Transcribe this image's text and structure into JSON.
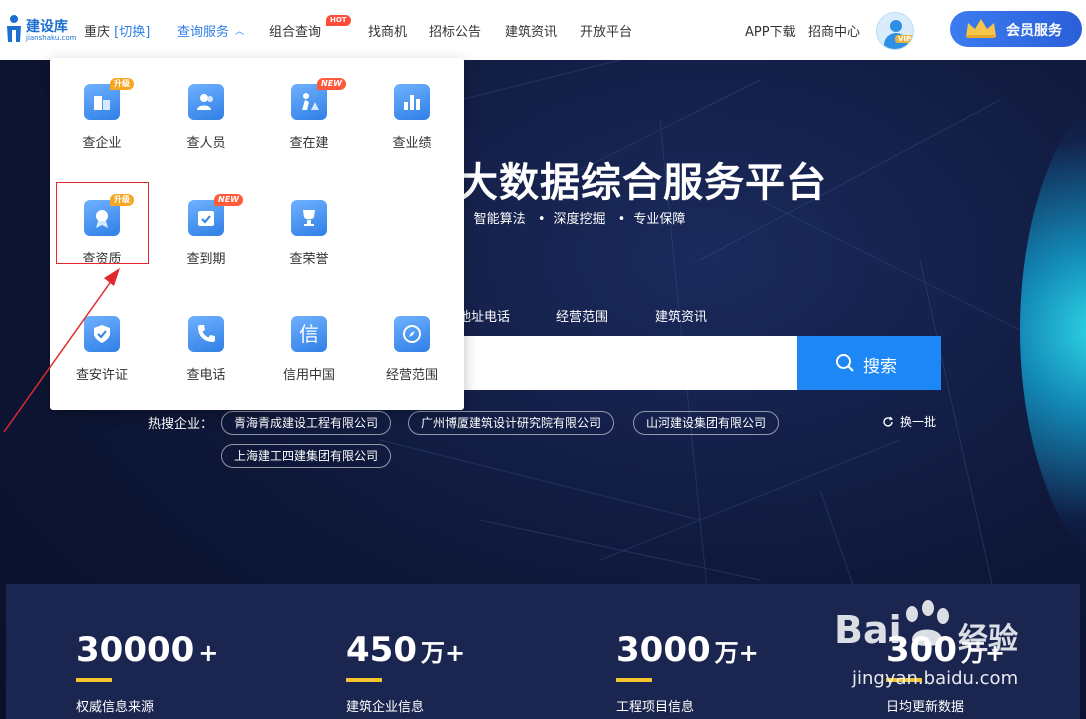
{
  "header": {
    "logo_name": "建设库",
    "logo_sub": "jianshaku.com",
    "city": "重庆",
    "city_switch": "[切换]",
    "nav": [
      {
        "label": "查询服务",
        "active": true
      },
      {
        "label": "组合查询",
        "badge": "HOT"
      },
      {
        "label": "找商机"
      },
      {
        "label": "招标公告"
      },
      {
        "label": "建筑资讯"
      },
      {
        "label": "开放平台"
      }
    ],
    "app_download": "APP下载",
    "merchant": "招商中心",
    "vip_tag": "VIP",
    "member_button": "会员服务"
  },
  "dropdown": {
    "items": [
      {
        "label": "查企业",
        "badge": "升级",
        "icon": "building-icon"
      },
      {
        "label": "查人员",
        "icon": "people-icon"
      },
      {
        "label": "查在建",
        "badge": "NEW",
        "icon": "construction-worker-icon"
      },
      {
        "label": "查业绩",
        "icon": "bar-chart-icon"
      },
      {
        "label": "查资质",
        "badge": "升级",
        "icon": "award-ribbon-icon"
      },
      {
        "label": "查到期",
        "badge": "NEW",
        "icon": "calendar-check-icon"
      },
      {
        "label": "查荣誉",
        "icon": "trophy-icon"
      },
      {
        "label": "查安许证",
        "icon": "shield-check-icon"
      },
      {
        "label": "查电话",
        "icon": "phone-icon"
      },
      {
        "label": "信用中国",
        "icon_text": "信",
        "icon": "credit-icon"
      },
      {
        "label": "经营范围",
        "icon": "compass-icon"
      }
    ]
  },
  "hero": {
    "title": "大数据综合服务平台",
    "tags": [
      "智能算法",
      "深度挖掘",
      "专业保障"
    ],
    "search_tabs": [
      "地址电话",
      "经营范围",
      "建筑资讯"
    ],
    "search_placeholder": "\"",
    "search_button": "搜索",
    "hot_label": "热搜企业：",
    "hot_companies": [
      "青海青成建设工程有限公司",
      "广州博厦建筑设计研究院有限公司",
      "山河建设集团有限公司",
      "上海建工四建集团有限公司"
    ],
    "refresh": "换一批"
  },
  "stats": [
    {
      "value": "30000",
      "suffix": "+",
      "caption": "权威信息来源"
    },
    {
      "value": "450",
      "suffix": "万+",
      "caption": "建筑企业信息"
    },
    {
      "value": "3000",
      "suffix": "万+",
      "caption": "工程项目信息"
    },
    {
      "value": "300",
      "suffix": "万+",
      "caption": "日均更新数据"
    }
  ],
  "watermark": {
    "brand": "Bai",
    "brand_ext": "经验",
    "url": "jingyan.baidu.com"
  },
  "colors": {
    "brand_blue": "#2f7fe6",
    "search_blue": "#1d88f5",
    "highlight_red": "#e0282e",
    "stat_bar": "#f2c230"
  }
}
